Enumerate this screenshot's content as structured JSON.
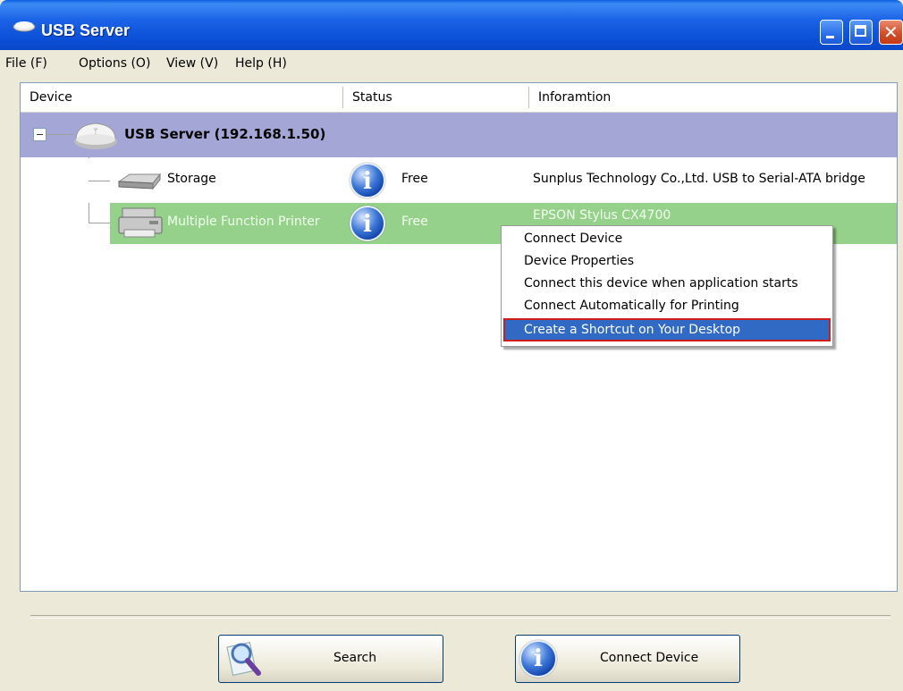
{
  "window": {
    "title": "USB Server"
  },
  "menu": [
    "File (F)",
    "Options (O)",
    "View (V)",
    "Help (H)"
  ],
  "columns": [
    "Device",
    "Status",
    "Inforamtion"
  ],
  "server": {
    "label": "USB Server  (192.168.1.50)"
  },
  "devices": [
    {
      "name": "Storage",
      "status": "Free",
      "info": "Sunplus Technology Co.,Ltd. USB to Serial-ATA bridge"
    },
    {
      "name": "Multiple Function Printer",
      "status": "Free",
      "info": "EPSON Stylus CX4700"
    }
  ],
  "context_menu": [
    "Connect Device",
    "Device Properties",
    "Connect this device when application starts",
    "Connect Automatically for Printing",
    "Create a Shortcut on Your Desktop"
  ],
  "buttons": {
    "search": "Search",
    "connect": "Connect Device"
  },
  "icons": {
    "info": "i"
  }
}
